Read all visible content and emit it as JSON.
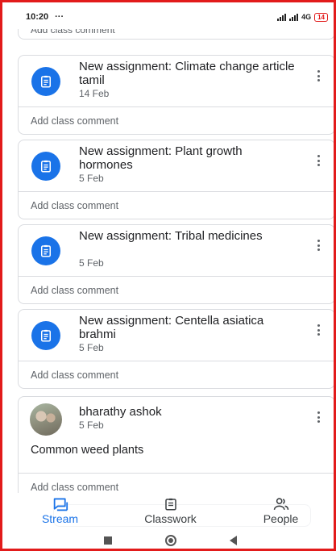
{
  "status_bar": {
    "time": "10:20",
    "dots": "···",
    "network": "4G",
    "battery": "14"
  },
  "stream": {
    "top_partial_comment": "Add class comment",
    "cards": [
      {
        "title": "New assignment: Climate change article tamil",
        "date": "14 Feb",
        "comment_placeholder": "Add class comment"
      },
      {
        "title": "New assignment: Plant growth hormones",
        "date": "5 Feb",
        "comment_placeholder": "Add class comment"
      },
      {
        "title": "New assignment: Tribal medicines",
        "date": "5 Feb",
        "comment_placeholder": "Add class comment"
      },
      {
        "title": "New assignment: Centella asiatica brahmi",
        "date": "5 Feb",
        "comment_placeholder": "Add class comment"
      }
    ],
    "post": {
      "author": "bharathy ashok",
      "date": "5 Feb",
      "text": "Common weed plants",
      "comment_placeholder": "Add class comment"
    }
  },
  "bottom_nav": {
    "items": [
      {
        "label": "Stream",
        "icon": "stream-icon",
        "active": true
      },
      {
        "label": "Classwork",
        "icon": "classwork-icon",
        "active": false
      },
      {
        "label": "People",
        "icon": "people-icon",
        "active": false
      }
    ]
  },
  "colors": {
    "accent": "#1a73e8",
    "frame": "#e21b1b"
  }
}
